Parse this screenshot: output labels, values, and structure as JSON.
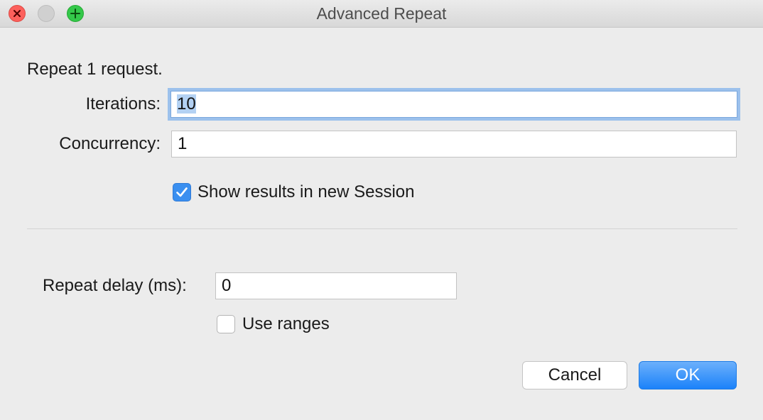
{
  "window": {
    "title": "Advanced Repeat"
  },
  "form": {
    "summary": "Repeat 1 request.",
    "iterations": {
      "label": "Iterations:",
      "value_selected": "10"
    },
    "concurrency": {
      "label": "Concurrency:",
      "value": "1"
    },
    "show_results": {
      "label": "Show results in new Session",
      "checked": true
    },
    "repeat_delay": {
      "label": "Repeat delay (ms):",
      "value": "0"
    },
    "use_ranges": {
      "label": "Use ranges",
      "checked": false
    }
  },
  "buttons": {
    "cancel": "Cancel",
    "ok": "OK"
  },
  "colors": {
    "accent": "#1b82fa",
    "close": "#fc605c",
    "zoom": "#34c84a",
    "checkbox_checked": "#3a8ff0",
    "focus_ring": "#9cc1ec"
  },
  "icons": {
    "close": "close-icon",
    "zoom": "plus-icon",
    "check": "checkmark-icon"
  }
}
